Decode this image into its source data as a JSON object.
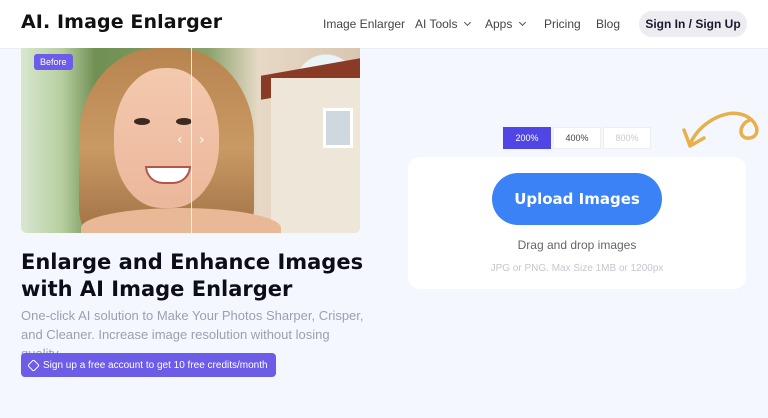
{
  "brand": {
    "name": "AI. Image Enlarger"
  },
  "nav": {
    "items": [
      {
        "label": "Image Enlarger",
        "dropdown": false
      },
      {
        "label": "AI Tools",
        "dropdown": true
      },
      {
        "label": "Apps",
        "dropdown": true
      },
      {
        "label": "Pricing",
        "dropdown": false
      },
      {
        "label": "Blog",
        "dropdown": false
      }
    ],
    "signin_label": "Sign In / Sign Up"
  },
  "hero": {
    "badge": "Before",
    "headline": "Enlarge and Enhance Images with AI Image Enlarger",
    "subtext": "One-click AI solution to Make Your Photos Sharper, Crisper, and Cleaner. Increase image resolution without losing quality.",
    "promo": "Sign up a free account to get 10 free credits/month"
  },
  "upload": {
    "scales": [
      {
        "label": "200%",
        "state": "active"
      },
      {
        "label": "400%",
        "state": "normal"
      },
      {
        "label": "800%",
        "state": "disabled"
      }
    ],
    "button_label": "Upload Images",
    "drag_text": "Drag and drop images",
    "limit_text": "JPG or PNG. Max Size 1MB or 1200px"
  },
  "colors": {
    "accent": "#6c5ce7",
    "upload_button": "#3b82f6",
    "active_tab": "#4f46e5",
    "swirl": "#e8b04a"
  },
  "icons": [
    "chevron-down-icon",
    "chevron-left-icon",
    "chevron-right-icon",
    "gem-icon",
    "swirl-arrow-icon"
  ]
}
